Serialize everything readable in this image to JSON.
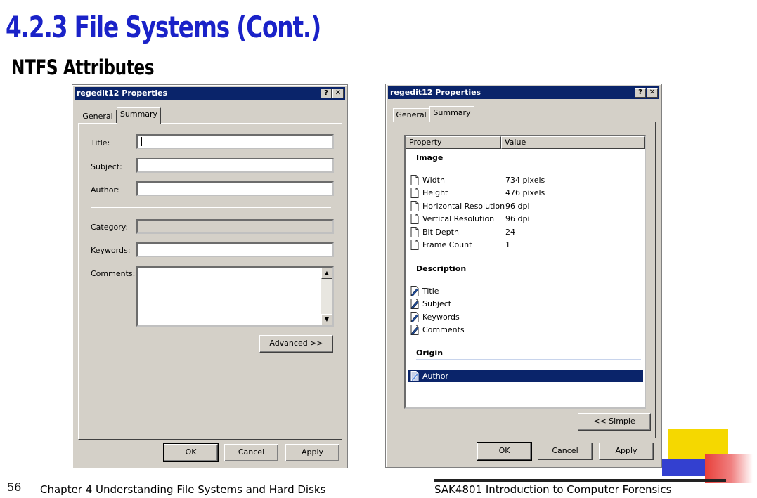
{
  "slide": {
    "title": "4.2.3  File Systems (Cont.)",
    "subtitle": "NTFS Attributes",
    "page_number": "56",
    "footer_left": "Chapter 4 Understanding File Systems and Hard Disks",
    "footer_right": "SAK4801  Introduction to Computer Forensics"
  },
  "left_window": {
    "title": "regedit12 Properties",
    "help_glyph": "?",
    "close_glyph": "✕",
    "tabs": [
      "General",
      "Summary"
    ],
    "active_tab": "Summary",
    "fields": {
      "title_label": "Title:",
      "subject_label": "Subject:",
      "author_label": "Author:",
      "category_label": "Category:",
      "keywords_label": "Keywords:",
      "comments_label": "Comments:"
    },
    "advanced_button": "Advanced >>",
    "ok_button": "OK",
    "cancel_button": "Cancel",
    "apply_button": "Apply"
  },
  "right_window": {
    "title": "regedit12 Properties",
    "help_glyph": "?",
    "close_glyph": "✕",
    "tabs": [
      "General",
      "Summary"
    ],
    "active_tab": "Summary",
    "columns": [
      "Property",
      "Value"
    ],
    "groups": {
      "image": {
        "label": "Image",
        "rows": [
          {
            "name": "Width",
            "value": "734 pixels",
            "icon": "document-icon"
          },
          {
            "name": "Height",
            "value": "476 pixels",
            "icon": "document-icon"
          },
          {
            "name": "Horizontal Resolution",
            "value": "96 dpi",
            "icon": "document-icon"
          },
          {
            "name": "Vertical Resolution",
            "value": "96 dpi",
            "icon": "document-icon"
          },
          {
            "name": "Bit Depth",
            "value": "24",
            "icon": "document-icon"
          },
          {
            "name": "Frame Count",
            "value": "1",
            "icon": "document-icon"
          }
        ]
      },
      "description": {
        "label": "Description",
        "rows": [
          {
            "name": "Title",
            "icon": "edit-document-icon"
          },
          {
            "name": "Subject",
            "icon": "edit-document-icon"
          },
          {
            "name": "Keywords",
            "icon": "edit-document-icon"
          },
          {
            "name": "Comments",
            "icon": "edit-document-icon"
          }
        ]
      },
      "origin": {
        "label": "Origin",
        "rows": [
          {
            "name": "Author",
            "icon": "edit-document-icon",
            "selected": true
          }
        ]
      }
    },
    "simple_button": "<< Simple",
    "ok_button": "OK",
    "cancel_button": "Cancel",
    "apply_button": "Apply"
  },
  "colors": {
    "title_blue": "#1a22c8",
    "titlebar": "#0a246a",
    "dialog_face": "#d4d0c8",
    "selection": "#0a246a",
    "deco_yellow": "#f5d800",
    "deco_blue": "#3340d0",
    "deco_red": "#e8403a"
  }
}
